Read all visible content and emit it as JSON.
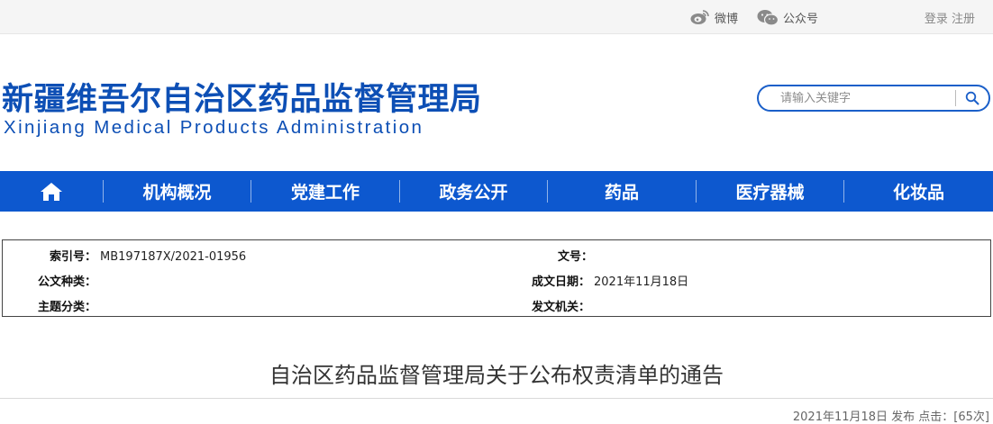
{
  "topbar": {
    "weibo_label": "微博",
    "wechat_label": "公众号",
    "login_label": "登录",
    "register_label": "注册"
  },
  "header": {
    "title_cn": "新疆维吾尔自治区药品监督管理局",
    "title_en": "Xinjiang Medical Products Administration",
    "search_placeholder": "请输入关键字"
  },
  "nav": {
    "items": [
      "机构概况",
      "党建工作",
      "政务公开",
      "药品",
      "医疗器械",
      "化妆品"
    ]
  },
  "info": {
    "index_label": "索引号：",
    "index_value": "MB197187X/2021-01956",
    "docno_label": "文号：",
    "docno_value": "",
    "doctype_label": "公文种类：",
    "doctype_value": "",
    "date_label": "成文日期：",
    "date_value": "2021年11月18日",
    "topic_label": "主题分类：",
    "topic_value": "",
    "issuer_label": "发文机关：",
    "issuer_value": ""
  },
  "article": {
    "title": "自治区药品监督管理局关于公布权责清单的通告",
    "meta": "2021年11月18日 发布 点击：[65次]"
  },
  "colors": {
    "brand_blue": "#0d4fb5",
    "nav_blue": "#0d58cf"
  },
  "icons": [
    "weibo-icon",
    "wechat-icon",
    "search-icon",
    "home-icon"
  ]
}
